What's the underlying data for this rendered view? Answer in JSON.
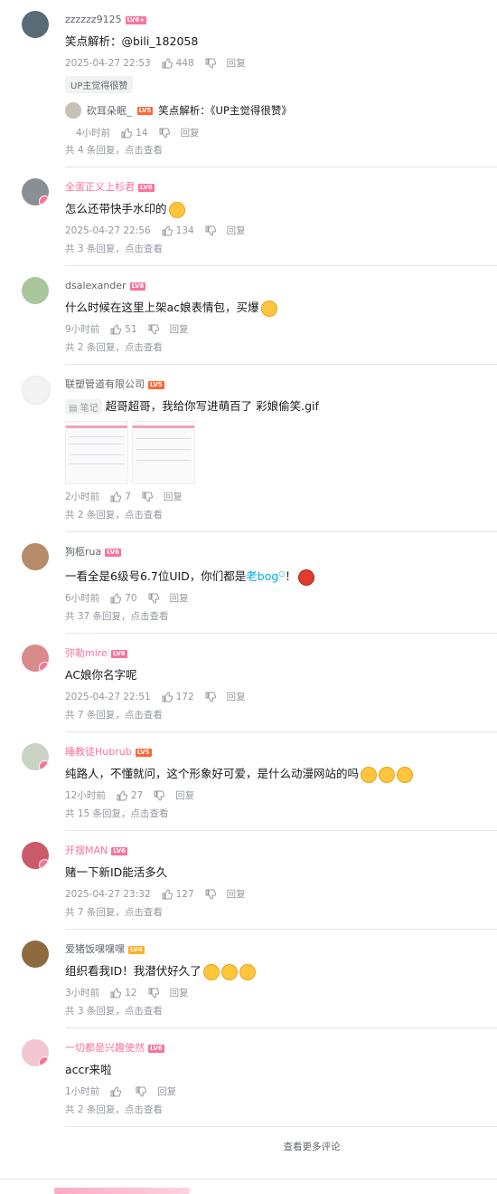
{
  "comments": [
    {
      "username": "zzzzzz9125",
      "level": "LV6+",
      "content": "笑点解析：@bili_182058",
      "time": "2025-04-27 22:53",
      "likes": "448",
      "reply_label": "回复",
      "tag": "UP主觉得很赞",
      "sub_reply": {
        "username": "砍耳朵眠_",
        "level": "LV5",
        "text": "笑点解析：《UP主觉得很赞》",
        "time": "4小时前",
        "likes": "14",
        "reply_label": "回复"
      },
      "replies_hint": "共 4 条回复，点击查看"
    },
    {
      "username": "全蛋正义上杉君",
      "level": "LV6",
      "content": "怎么还带快手水印的",
      "time": "2025-04-27 22:56",
      "likes": "134",
      "reply_label": "回复",
      "replies_hint": "共 3 条回复，点击查看"
    },
    {
      "username": "dsalexander",
      "level": "LV6",
      "content": "什么时候在这里上架ac娘表情包，买爆",
      "time": "9小时前",
      "likes": "51",
      "reply_label": "回复",
      "replies_hint": "共 2 条回复，点击查看"
    },
    {
      "username": "联塑管道有限公司",
      "level": "LV5",
      "note_label": "笔记",
      "content": "超哥超哥，我给你写进萌百了 彩娘偷笑.gif",
      "time": "2小时前",
      "likes": "7",
      "reply_label": "回复",
      "replies_hint": "共 2 条回复，点击查看"
    },
    {
      "username": "狗柩rua",
      "level": "LV6",
      "content_pre": "一看全是6级号6.7位UID，你们都是",
      "content_link": "老bog",
      "content_post": "！",
      "time": "6小时前",
      "likes": "70",
      "reply_label": "回复",
      "replies_hint": "共 37 条回复，点击查看"
    },
    {
      "username": "弥勒mire",
      "level": "LV6",
      "content": "AC娘你名字呢",
      "time": "2025-04-27 22:51",
      "likes": "172",
      "reply_label": "回复",
      "replies_hint": "共 7 条回复，点击查看"
    },
    {
      "username": "睡教徒Hubrub",
      "level": "LV5",
      "content": "纯路人，不懂就问，这个形象好可爱，是什么动漫网站的吗",
      "time": "12小时前",
      "likes": "27",
      "reply_label": "回复",
      "replies_hint": "共 15 条回复，点击查看"
    },
    {
      "username": "开摆MAN",
      "level": "LV6",
      "content": "赌一下新ID能活多久",
      "time": "2025-04-27 23:32",
      "likes": "127",
      "reply_label": "回复",
      "replies_hint": "共 7 条回复，点击查看"
    },
    {
      "username": "爱猪饭嘿嘿嘿",
      "level": "LV4",
      "content": "组织看我ID！我潜伏好久了",
      "time": "3小时前",
      "likes": "12",
      "reply_label": "回复",
      "replies_hint": "共 3 条回复，点击查看"
    },
    {
      "username": "一切都是兴趣使然",
      "level": "LV6",
      "content": "accr来啦",
      "time": "1小时前",
      "likes": "",
      "reply_label": "回复",
      "replies_hint": "共 2 条回复，点击查看"
    }
  ],
  "more_comments_label": "查看更多评论"
}
